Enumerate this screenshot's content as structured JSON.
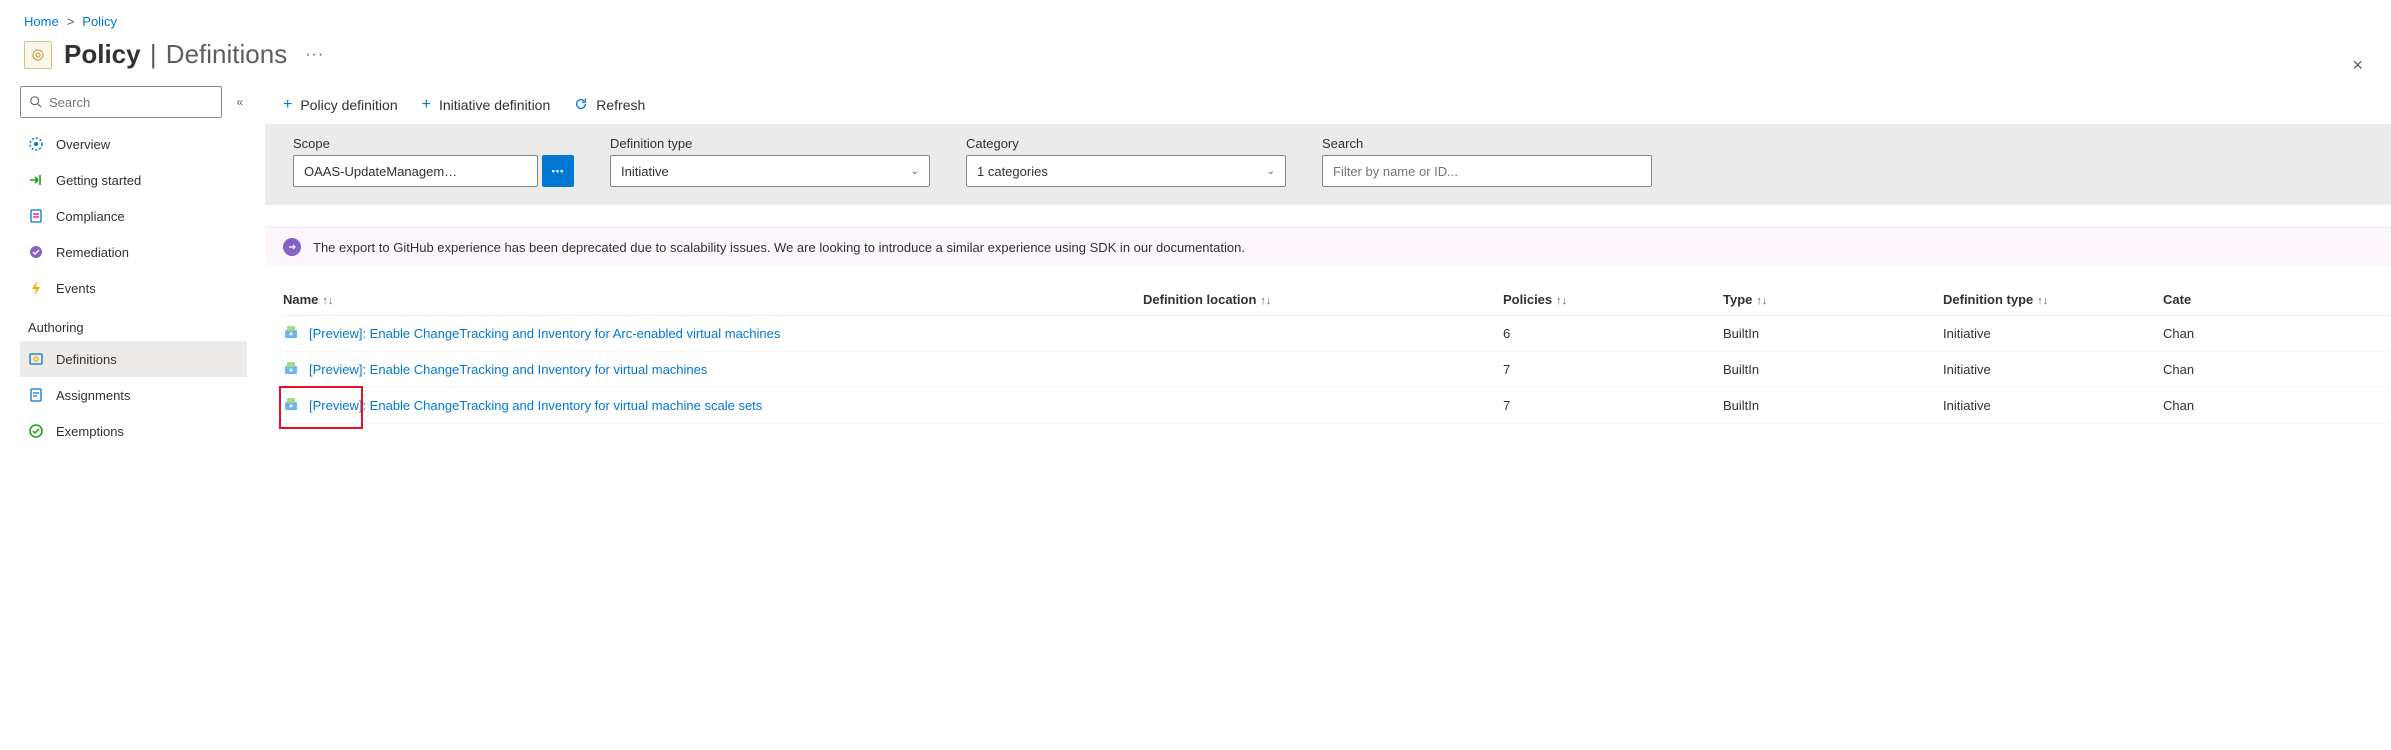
{
  "breadcrumb": {
    "home": "Home",
    "policy": "Policy"
  },
  "header": {
    "title": "Policy",
    "subtitle": "Definitions",
    "more": "···",
    "close": "×"
  },
  "sidebar": {
    "search_placeholder": "Search",
    "items_main": [
      {
        "label": "Overview"
      },
      {
        "label": "Getting started"
      },
      {
        "label": "Compliance"
      },
      {
        "label": "Remediation"
      },
      {
        "label": "Events"
      }
    ],
    "section_authoring": "Authoring",
    "items_auth": [
      {
        "label": "Definitions"
      },
      {
        "label": "Assignments"
      },
      {
        "label": "Exemptions"
      }
    ]
  },
  "toolbar": {
    "policy_def": "Policy definition",
    "initiative_def": "Initiative definition",
    "refresh": "Refresh"
  },
  "filters": {
    "scope_label": "Scope",
    "scope_value": "OAAS-UpdateManagem…",
    "deftype_label": "Definition type",
    "deftype_value": "Initiative",
    "category_label": "Category",
    "category_value": "1 categories",
    "search_label": "Search",
    "search_placeholder": "Filter by name or ID..."
  },
  "notice": "The export to GitHub experience has been deprecated due to scalability issues. We are looking to introduce a similar experience using SDK in our documentation.",
  "table": {
    "headers": {
      "name": "Name",
      "location": "Definition location",
      "policies": "Policies",
      "type": "Type",
      "deftype": "Definition type",
      "category": "Cate"
    },
    "rows": [
      {
        "name": "[Preview]: Enable ChangeTracking and Inventory for Arc-enabled virtual machines",
        "location": "",
        "policies": "6",
        "type": "BuiltIn",
        "deftype": "Initiative",
        "category": "Chan"
      },
      {
        "name": "[Preview]: Enable ChangeTracking and Inventory for virtual machines",
        "location": "",
        "policies": "7",
        "type": "BuiltIn",
        "deftype": "Initiative",
        "category": "Chan"
      },
      {
        "name": "[Preview]: Enable ChangeTracking and Inventory for virtual machine scale sets",
        "location": "",
        "policies": "7",
        "type": "BuiltIn",
        "deftype": "Initiative",
        "category": "Chan"
      }
    ]
  }
}
